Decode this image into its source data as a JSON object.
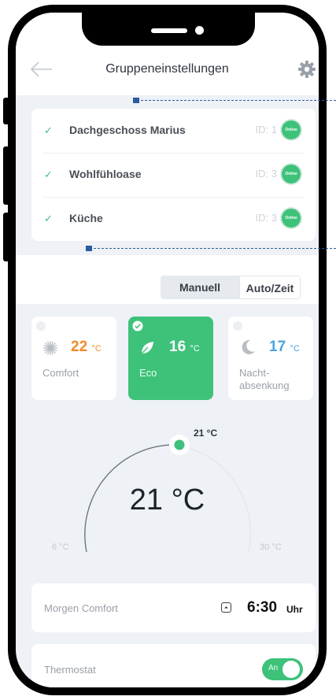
{
  "header": {
    "title": "Gruppeneinstellungen"
  },
  "groups": [
    {
      "name": "Dachgeschoss Marius",
      "id": "ID: 1",
      "status": "Online"
    },
    {
      "name": "Wohlfühloase",
      "id": "ID: 3",
      "status": "Online"
    },
    {
      "name": "Küche",
      "id": "ID: 3",
      "status": "Online"
    }
  ],
  "mode": {
    "manual": "Manuell",
    "auto": "Auto/Zeit",
    "selected": "Manuell"
  },
  "presets": [
    {
      "value": "22",
      "unit": "°C",
      "label": "Comfort",
      "color": "#f08a2a",
      "icon": "sun-icon"
    },
    {
      "value": "16",
      "unit": "°C",
      "label": "Eco",
      "color": "#ffffff",
      "icon": "leaf-icon",
      "selected": true
    },
    {
      "value": "17",
      "unit": "°C",
      "label": "Nacht-",
      "label2": "absenkung",
      "color": "#4aa3df",
      "icon": "moon-icon"
    }
  ],
  "dial": {
    "current": "21 °C",
    "target": "21 °C",
    "min": "6 °C",
    "max": "30 °C"
  },
  "schedule": {
    "name": "Morgen Comfort",
    "time": "6:30",
    "unit": "Uhr"
  },
  "thermostat": {
    "label": "Thermostat",
    "toggle": "An",
    "on": true
  },
  "colors": {
    "accent": "#3ec27a",
    "background": "#eef1f5"
  }
}
